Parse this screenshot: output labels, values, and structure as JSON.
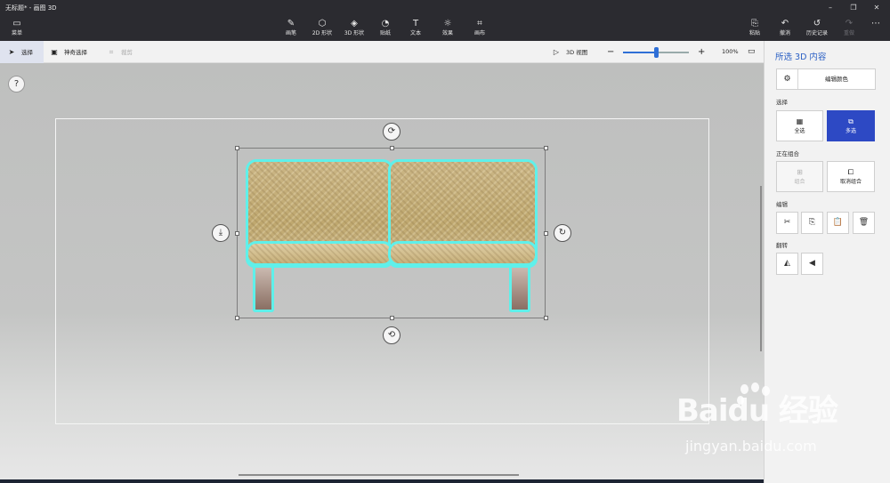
{
  "window": {
    "title": "无标题* - 画图 3D"
  },
  "toolbar": {
    "menu": {
      "label": "菜单",
      "icon": "folder-icon"
    },
    "tools": [
      {
        "label": "画笔",
        "icon": "brush-icon"
      },
      {
        "label": "2D 形状",
        "icon": "2d-shapes-icon"
      },
      {
        "label": "3D 形状",
        "icon": "3d-shapes-icon"
      },
      {
        "label": "贴纸",
        "icon": "sticker-icon"
      },
      {
        "label": "文本",
        "icon": "text-icon"
      },
      {
        "label": "效果",
        "icon": "effects-icon"
      },
      {
        "label": "画布",
        "icon": "canvas-icon"
      }
    ],
    "right": [
      {
        "label": "粘贴",
        "icon": "paste-icon"
      },
      {
        "label": "撤消",
        "icon": "undo-icon"
      },
      {
        "label": "历史记录",
        "icon": "history-icon"
      },
      {
        "label": "重做",
        "icon": "redo-icon"
      }
    ]
  },
  "subbar": {
    "select_label": "选择",
    "magic_select_label": "神奇选择",
    "crop_label": "裁剪",
    "view3d_label": "3D 视图",
    "zoom_minus": "−",
    "zoom_plus": "+",
    "zoom_value": "100%",
    "zoom_level": 0.5
  },
  "canvas": {
    "help": "?"
  },
  "panel": {
    "title": "所选 3D 内容",
    "edit_color": "编辑颜色",
    "select_section": "选择",
    "select_all": "全选",
    "multi_select": "多选",
    "group_section": "正在组合",
    "group": "组合",
    "ungroup": "取消组合",
    "edit_section": "编辑",
    "flip_section": "翻转"
  },
  "watermark": {
    "logo": "Baidu 经验",
    "site": "jingyan.baidu.com"
  },
  "colors": {
    "accent": "#2d49c4",
    "selection_glow": "#5ff0ea",
    "titlebar": "#2b2b30"
  }
}
